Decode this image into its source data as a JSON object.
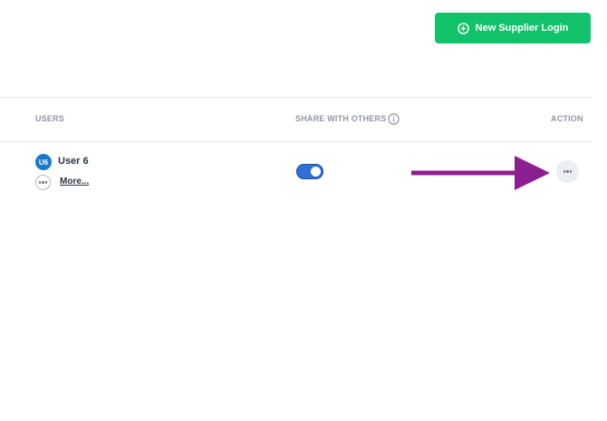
{
  "header": {
    "new_button_label": "New Supplier Login"
  },
  "table": {
    "columns": {
      "users": "USERS",
      "share": "SHARE WITH OTHERS",
      "action": "ACTION"
    },
    "rows": [
      {
        "avatar_initials": "U6",
        "name": "User 6",
        "more_label": "More...",
        "share_enabled": true
      }
    ]
  },
  "icons": {
    "new_button": "plus-circle-icon",
    "share_info": "info-icon",
    "row_more": "ellipsis-icon",
    "row_action": "ellipsis-icon",
    "annotation": "arrow-icon"
  },
  "colors": {
    "primary_button": "#12c26b",
    "toggle_on": "#2e6fd8",
    "avatar": "#1c78cc",
    "annotation_arrow": "#8b1f92"
  }
}
